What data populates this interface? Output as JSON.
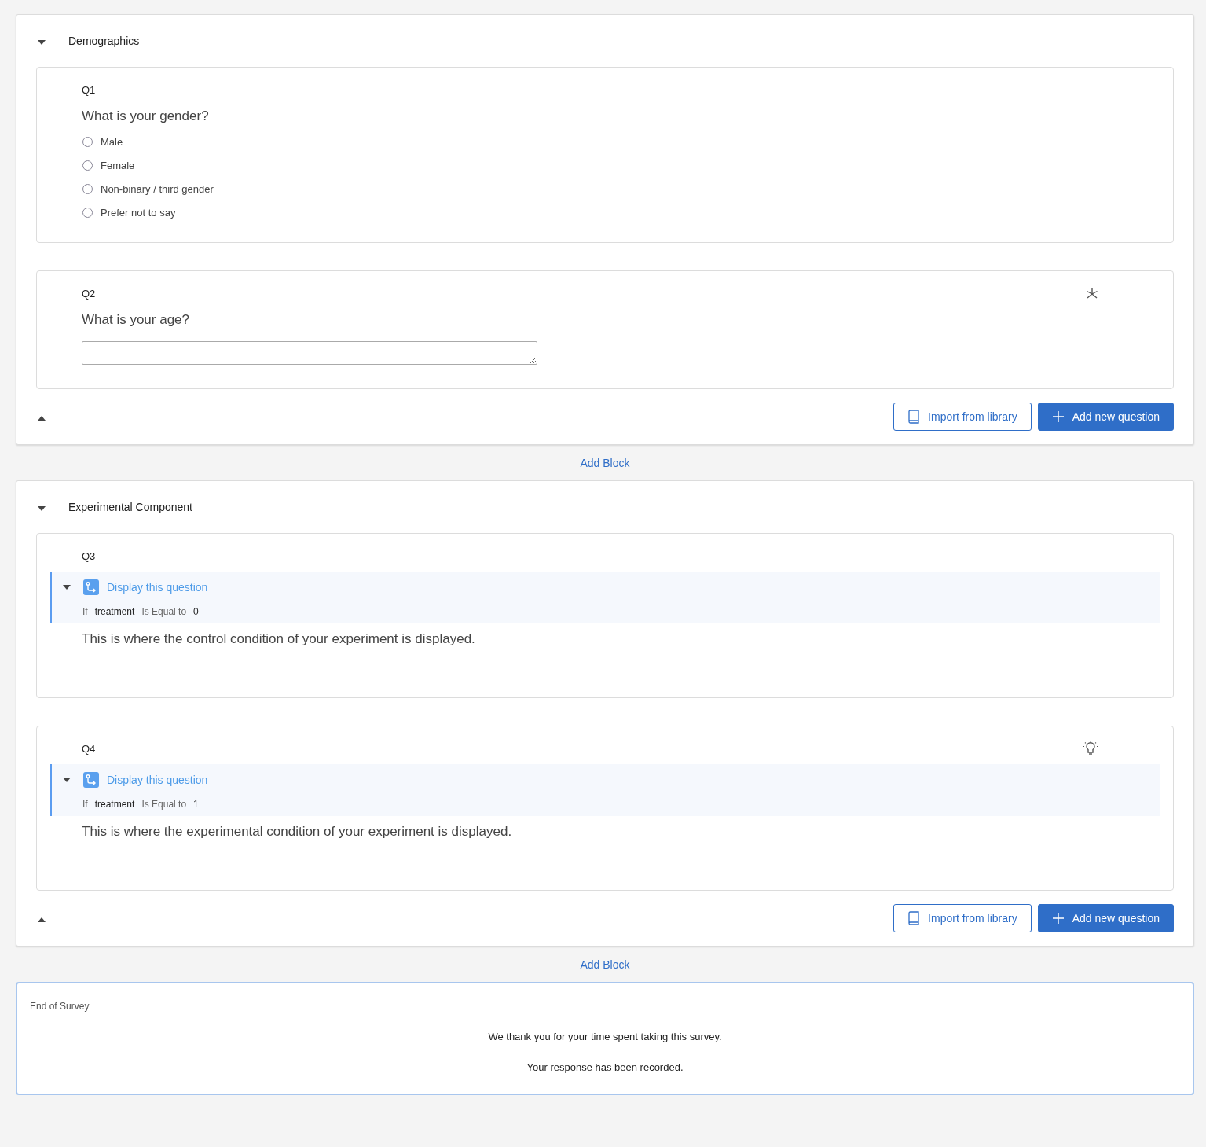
{
  "blocks": [
    {
      "title": "Demographics",
      "expanded": true,
      "questions": [
        {
          "number": "Q1",
          "kind": "multiple_choice",
          "text": "What is your gender?",
          "options": [
            {
              "label": "Male",
              "selected": false
            },
            {
              "label": "Female",
              "selected": false
            },
            {
              "label": "Non-binary / third gender",
              "selected": false
            },
            {
              "label": "Prefer not to say",
              "selected": false
            }
          ]
        },
        {
          "number": "Q2",
          "kind": "text_entry",
          "text": "What is your age?",
          "required": true
        }
      ],
      "import_button": "Import from library",
      "add_button": "Add new question"
    },
    {
      "title": "Experimental Component",
      "expanded": true,
      "questions": [
        {
          "number": "Q3",
          "kind": "descriptive",
          "text": "This is where the control condition of your experiment is displayed.",
          "logic": {
            "expanded": true,
            "title": "Display this question",
            "if": "If",
            "field": "treatment",
            "operator": "Is Equal to",
            "value": "0"
          }
        },
        {
          "number": "Q4",
          "kind": "descriptive",
          "text": "This is where the experimental condition of your experiment is displayed.",
          "tip": true,
          "logic": {
            "expanded": true,
            "title": "Display this question",
            "if": "If",
            "field": "treatment",
            "operator": "Is Equal to",
            "value": "1"
          }
        }
      ],
      "import_button": "Import from library",
      "add_button": "Add new question"
    }
  ],
  "add_block_links": [
    "Add Block",
    "Add Block"
  ],
  "end_of_survey": {
    "label": "End of Survey",
    "messages": [
      "We thank you for your time spent taking this survey.",
      "Your response has been recorded."
    ]
  }
}
